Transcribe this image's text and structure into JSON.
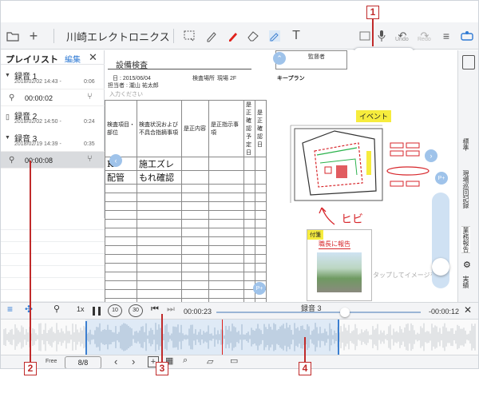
{
  "toolbar": {
    "doc_title": "川崎エレクトロニクス",
    "undo_label": "Undo",
    "redo_label": "Redo"
  },
  "sidebar": {
    "title": "プレイリスト",
    "edit": "編集",
    "groups": [
      {
        "name": "録音 1",
        "date": "2018/02/02 14:43 -",
        "duration": "0:06",
        "clip_time": "00:00:02"
      },
      {
        "name": "録音 2",
        "date": "2018/02/02 14:50 -",
        "duration": "0:24"
      },
      {
        "name": "録音 3",
        "date": "2018/02/19 14:39 -",
        "duration": "0:35",
        "clip_time": "00:00:08"
      }
    ]
  },
  "document": {
    "heading": "設備検査",
    "date_line": "日 : 2015/06/04",
    "place_label": "検査場所",
    "place_value": "現場 2F",
    "inspector_line": "担当者 : 瀧山 祐太郎",
    "input_hint": "入力ください",
    "supervisor": "監督者",
    "keyplan": "キープラン",
    "event_tag": "イベント",
    "table_headers": [
      "検査項目・部位",
      "検査状況および不具合指摘事項",
      "是正内容",
      "是正指示事項",
      "是正 確認 予定日",
      "是正 確認日"
    ],
    "table_rows": [
      [
        "K",
        "施工ズレ"
      ],
      [
        "配管",
        "もれ確認"
      ]
    ],
    "hibi": "ヒビ",
    "fusen_label": "付箋",
    "fusen_note": "職長に報告",
    "photo_hint": "タップしてイメージを追"
  },
  "right_tabs": [
    "標準",
    "現場巡回記録",
    "業務報告",
    "実績"
  ],
  "playback": {
    "speed": "1x",
    "skip_back": "10",
    "skip_fwd": "30",
    "current": "00:00:23",
    "title": "録音 3",
    "remaining": "-00:00:12",
    "progress": 0.63
  },
  "bottom": {
    "free_label": "Free",
    "page": "8/8"
  },
  "callouts": [
    "1",
    "2",
    "3",
    "4"
  ],
  "colors": {
    "accent": "#3c7fd0",
    "record_red": "#e0221c",
    "callout_red": "#c02a2a",
    "highlight_yellow": "#f6ec3d"
  }
}
